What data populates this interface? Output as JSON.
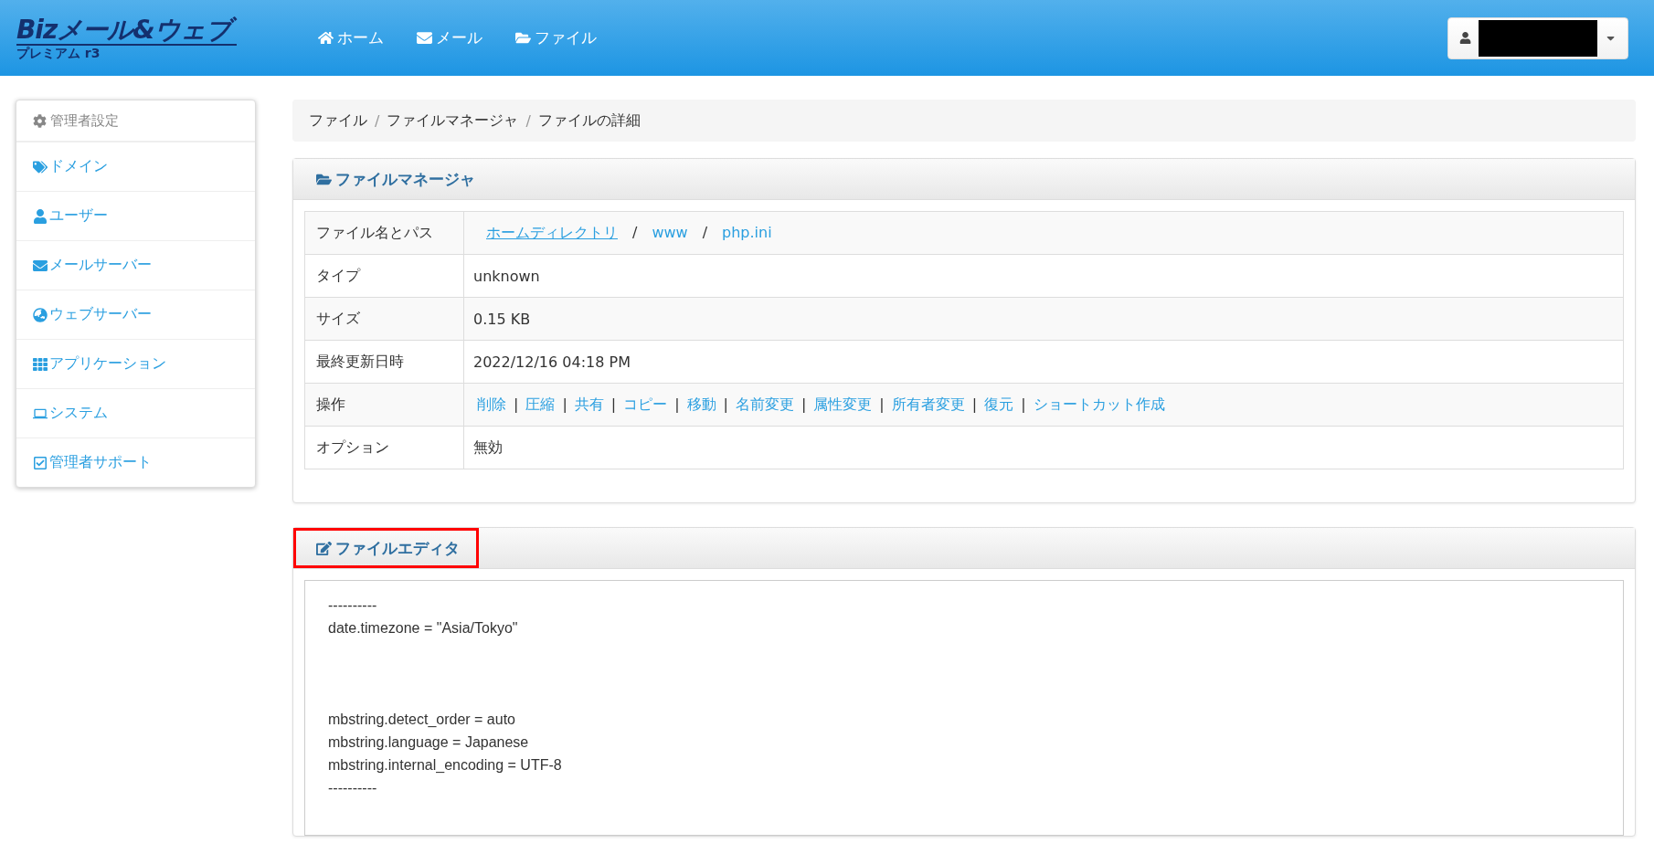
{
  "header": {
    "logo": {
      "title": "Bizメール&ウェブ",
      "subtitle": "プレミアム r3"
    },
    "nav": [
      {
        "kind": "home",
        "label": "ホーム"
      },
      {
        "kind": "mail",
        "label": "メール"
      },
      {
        "kind": "folder",
        "label": "ファイル"
      }
    ],
    "user_menu": {
      "name_redacted": true
    }
  },
  "sidebar": {
    "heading": "管理者設定",
    "items": [
      {
        "kind": "tag",
        "label": "ドメイン"
      },
      {
        "kind": "user",
        "label": "ユーザー"
      },
      {
        "kind": "mail",
        "label": "メールサーバー"
      },
      {
        "kind": "globe",
        "label": "ウェブサーバー"
      },
      {
        "kind": "grid",
        "label": "アプリケーション"
      },
      {
        "kind": "system",
        "label": "システム"
      },
      {
        "kind": "check",
        "label": "管理者サポート"
      }
    ]
  },
  "breadcrumb": [
    {
      "label": "ファイル",
      "separator": "/"
    },
    {
      "label": "ファイルマネージャ",
      "separator": "/"
    },
    {
      "label": "ファイルの詳細"
    }
  ],
  "file_manager": {
    "title": "ファイルマネージャ",
    "rows": [
      {
        "kind": "path",
        "label": "ファイル名とパス",
        "links": [
          {
            "label": "ホームディレクトリ",
            "underline": true,
            "separator": "/"
          },
          {
            "label": "www",
            "underline": false,
            "separator": "/"
          },
          {
            "label": "php.ini",
            "underline": false
          }
        ]
      },
      {
        "kind": "text",
        "label": "タイプ",
        "value": "unknown"
      },
      {
        "kind": "text",
        "label": "サイズ",
        "value": "0.15 KB"
      },
      {
        "kind": "text",
        "label": "最終更新日時",
        "value": "2022/12/16 04:18 PM"
      },
      {
        "kind": "actions",
        "label": "操作",
        "links": [
          {
            "label": "削除",
            "separator": "|"
          },
          {
            "label": "圧縮",
            "separator": "|"
          },
          {
            "label": "共有",
            "separator": "|"
          },
          {
            "label": "コピー",
            "separator": "|"
          },
          {
            "label": "移動",
            "separator": "|"
          },
          {
            "label": "名前変更",
            "separator": "|"
          },
          {
            "label": "属性変更",
            "separator": "|"
          },
          {
            "label": "所有者変更",
            "separator": "|"
          },
          {
            "label": "復元",
            "separator": "|"
          },
          {
            "label": "ショートカット作成"
          }
        ]
      },
      {
        "kind": "text",
        "label": "オプション",
        "value": "無効"
      }
    ]
  },
  "file_editor": {
    "title": "ファイルエディタ",
    "highlighted": true,
    "content": "----------\ndate.timezone = \"Asia/Tokyo\"\n\n\n\nmbstring.detect_order = auto\nmbstring.language = Japanese\nmbstring.internal_encoding = UTF-8\n----------"
  }
}
